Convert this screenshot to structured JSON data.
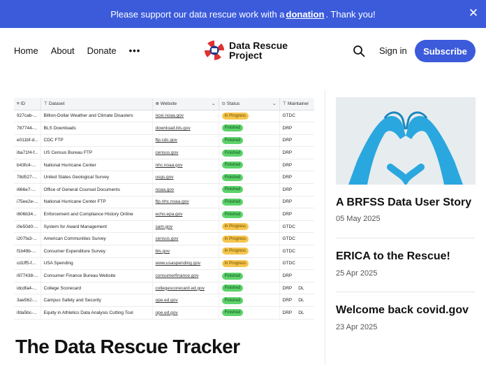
{
  "banner": {
    "text_before": "Please support our data rescue work with a",
    "link": "donation",
    "text_after": ". Thank you!"
  },
  "nav": {
    "home": "Home",
    "about": "About",
    "donate": "Donate",
    "more": "•••"
  },
  "logo": {
    "line1": "Data Rescue",
    "line2": "Project"
  },
  "header_actions": {
    "signin": "Sign in",
    "subscribe": "Subscribe"
  },
  "table": {
    "columns": [
      "ID",
      "Dataset",
      "Website",
      "Status",
      "Maintainer"
    ],
    "rows": [
      [
        "927cab-...",
        "Billion-Dollar Weather and Climate Disasters",
        "ncei.noaa.gov",
        "In Progress",
        "GTDC",
        ""
      ],
      [
        "787744-...",
        "BLS Downloads",
        "download.bls.gov",
        "Finished",
        "DRP",
        ""
      ],
      [
        "e011bf-d...",
        "CDC FTP",
        "ftp.cdc.gov",
        "Finished",
        "DRP",
        ""
      ],
      [
        "iba71f4-f...",
        "US Census Bureau FTP",
        "census.gov",
        "Finished",
        "DRP",
        ""
      ],
      [
        "b43fc4-...",
        "National Hurricane Center",
        "nhc.noaa.gov",
        "Finished",
        "DRP",
        ""
      ],
      [
        "78d527-...",
        "United States Geological Survey",
        "usgs.gov",
        "Finished",
        "DRP",
        ""
      ],
      [
        "i666e7-...",
        "Office of General Counsel Documents",
        "noaa.gov",
        "Finished",
        "DRP",
        ""
      ],
      [
        "i75ee2e-...",
        "National Hurricane Center FTP",
        "ftp.nhc.noaa.gov",
        "Finished",
        "DRP",
        ""
      ],
      [
        "i606b34...",
        "Enforcement and Compliance History Online",
        "echo.epa.gov",
        "Finished",
        "DRP",
        ""
      ],
      [
        "i0e50d0-...",
        "System for Award Management",
        "sam.gov",
        "In Progress",
        "GTDC",
        ""
      ],
      [
        "i207fa3-...",
        "American Communities Survey",
        "census.gov",
        "In Progress",
        "GTDC",
        ""
      ],
      [
        "f1b49b-...",
        "Consumer Expenditure Survey",
        "bls.gov",
        "In Progress",
        "GTDC",
        ""
      ],
      [
        "cd1ff5-f...",
        "USA Spending",
        "www.usaspending.gov",
        "In Progress",
        "GTDC",
        ""
      ],
      [
        "i977438-...",
        "Consumer Finance Bureau Website",
        "consumerfinance.gov",
        "Finished",
        "DRP",
        ""
      ],
      [
        "idcdfa4-...",
        "College Scorecard",
        "collegescorecard.ed.gov",
        "Finished",
        "DRP",
        "DL"
      ],
      [
        "3ae562-...",
        "Campus Safety and Security",
        "ope.ed.gov",
        "Finished",
        "DRP",
        "DL"
      ],
      [
        "ifda5bc-...",
        "Equity in Athletics Data Analysis Cutting Tool",
        "ope.ed.gov",
        "Finished",
        "DRP",
        "DL"
      ]
    ]
  },
  "page_title": "The Data Rescue Tracker",
  "posts": [
    {
      "title": "A BRFSS Data User Story",
      "date": "05 May 2025"
    },
    {
      "title": "ERICA to the Rescue!",
      "date": "25 Apr 2025"
    },
    {
      "title": "Welcome back covid.gov",
      "date": "23 Apr 2025"
    }
  ],
  "colors": {
    "accent": "#3b5bdb",
    "finished": "#5dd36b",
    "in_progress": "#f5c54d"
  }
}
